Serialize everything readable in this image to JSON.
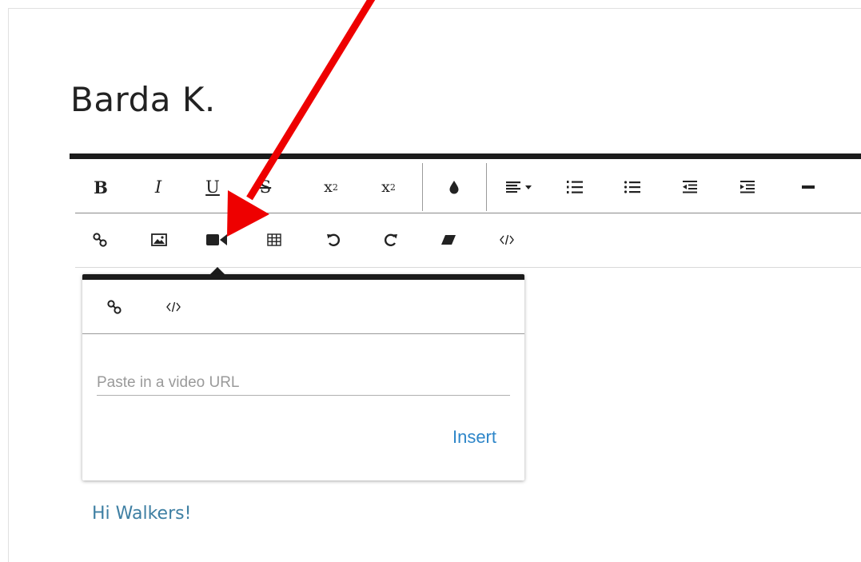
{
  "page": {
    "title": "Barda K."
  },
  "toolbar_row1": [
    {
      "name": "bold-button",
      "label": "B"
    },
    {
      "name": "italic-button",
      "label": "I"
    },
    {
      "name": "underline-button",
      "label": "U"
    },
    {
      "name": "strikethrough-button",
      "label": "S"
    },
    {
      "name": "subscript-button",
      "label": "x",
      "sub": "2"
    },
    {
      "name": "superscript-button",
      "label": "x",
      "sup": "2"
    },
    {
      "name": "text-color-button",
      "icon": "drop-icon"
    },
    {
      "name": "align-button",
      "icon": "align-left-icon"
    },
    {
      "name": "ordered-list-button",
      "icon": "ordered-list-icon"
    },
    {
      "name": "unordered-list-button",
      "icon": "unordered-list-icon"
    },
    {
      "name": "outdent-button",
      "icon": "outdent-icon"
    },
    {
      "name": "indent-button",
      "icon": "indent-icon"
    },
    {
      "name": "horizontal-rule-button",
      "icon": "horizontal-rule-icon"
    }
  ],
  "toolbar_row2": [
    {
      "name": "insert-link-button",
      "icon": "link-icon"
    },
    {
      "name": "insert-image-button",
      "icon": "image-icon"
    },
    {
      "name": "insert-video-button",
      "icon": "video-camera-icon"
    },
    {
      "name": "insert-table-button",
      "icon": "table-icon"
    },
    {
      "name": "undo-button",
      "icon": "undo-icon"
    },
    {
      "name": "redo-button",
      "icon": "redo-icon"
    },
    {
      "name": "clear-formatting-button",
      "icon": "eraser-icon"
    },
    {
      "name": "code-view-button",
      "icon": "code-icon"
    }
  ],
  "video_popup": {
    "tabs": [
      {
        "name": "video-by-url-tab",
        "icon": "link-icon"
      },
      {
        "name": "video-embed-tab",
        "icon": "code-icon"
      }
    ],
    "url_placeholder": "Paste in a video URL",
    "insert_label": "Insert"
  },
  "content": {
    "greeting": "Hi Walkers!"
  },
  "colors": {
    "accent": "#2e86c9",
    "bar": "#1b1b1b",
    "annotation_arrow": "#ee0000"
  }
}
